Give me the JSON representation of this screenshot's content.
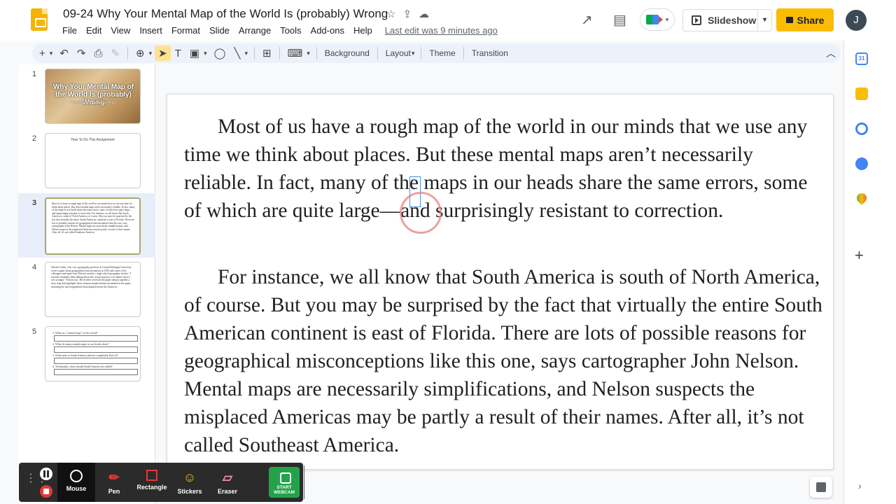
{
  "header": {
    "doc_title": "09-24 Why Your Mental Map of the World Is (probably) Wrong",
    "title_icons": [
      "☆",
      "⇪",
      "☁"
    ],
    "menu": [
      "File",
      "Edit",
      "View",
      "Insert",
      "Format",
      "Slide",
      "Arrange",
      "Tools",
      "Add-ons",
      "Help"
    ],
    "last_edit": "Last edit was 9 minutes ago",
    "slideshow_label": "Slideshow",
    "share_label": "Share",
    "avatar_initial": "J",
    "trend_icon": "↗",
    "comment_icon": "▤"
  },
  "toolbar": {
    "background": "Background",
    "layout": "Layout",
    "theme": "Theme",
    "transition": "Transition",
    "icons": {
      "add": "+",
      "undo": "↶",
      "redo": "↷",
      "print": "⎙",
      "paint": "✎",
      "zoom": "⊕",
      "select": "➤",
      "textbox": "T",
      "image": "▣",
      "shape": "◯",
      "line": "╲",
      "comment": "⊞",
      "input": "⌨",
      "dropdown": "▾",
      "collapse": "︿"
    }
  },
  "filmstrip": {
    "slide_numbers": [
      "1",
      "2",
      "3",
      "4",
      "5"
    ],
    "slide1": {
      "title": "Why Your Mental Map of the World Is (probably) Wrong",
      "subtitle": "What's Wrong With Flat Maps"
    },
    "slide2": {
      "title": "How To Do This Assignment"
    },
    "slide3": {
      "text": "Most of us have a rough map of the world in our minds that we use any time we think about places. But these mental maps aren't necessarily reliable. In fact, many of the maps in our heads share the same errors, some of which are quite large—and surprisingly resistant to correction. For instance, we all know that South America is south of North America, of course. But you may be surprised by the fact that virtually the entire South American continent is east of Florida. There are lots of possible reasons for geographical misconceptions like this one, says cartographer John Nelson. Mental maps are necessarily simplifications, and Nelson suspects the misplaced Americas may be partly a result of their names. After all, it's not called Southeast America."
    },
    "slide4": {
      "text": "Nelson's father, who was a geography professor at Central Michigan University, wrote a paper about geographical misconceptions in 1992 with some of his colleagues and input from Nelson's mother, a high-school geography teacher. \"I actually remember them talking about this research project over dinner when I was younger,\" Nelson says. He recently reviewed the paper and put together a story map that highlights three common misplacements mentioned in the paper, including the true longitudinal relationship between the Americas."
    },
    "slide5": {
      "questions": [
        "1.   What is a \"mental map\" of the world?",
        "2.   What do many mental maps in our heads share?",
        "3.   What state is South America almost completely East of?",
        "4.   Technically, what should South America be called?"
      ]
    }
  },
  "slide": {
    "paragraph1": "Most of us have a rough map of the world in our minds that we use any time we think about places. But these mental maps aren’t necessarily reliable. In fact, many of the maps in our heads share the same errors, some of which are quite large—and surprisingly resistant to correction.",
    "paragraph2": "For instance, we all know that South America is south of North America, of course. But you may be surprised by the fact that virtually the entire South American continent is east of Florida. There are lots of possible reasons for geographical misconceptions like this one, says cartographer John Nelson. Mental maps are necessarily simplifications, and Nelson suspects the misplaced Americas may be partly a result of their names. After all, it’s not called Southeast America."
  },
  "recorder": {
    "tools": [
      "Mouse",
      "Pen",
      "Rectangle",
      "Stickers",
      "Eraser"
    ],
    "webcam_label": "START WEBCAM",
    "icons": {
      "pen": "✏",
      "stickers": "☺",
      "eraser": "▱",
      "collapse": "‹",
      "grip": "⋮⋮"
    }
  },
  "sidepanel": {
    "calendar_label": "31",
    "plus_icon": "+",
    "chevron_icon": "›"
  }
}
